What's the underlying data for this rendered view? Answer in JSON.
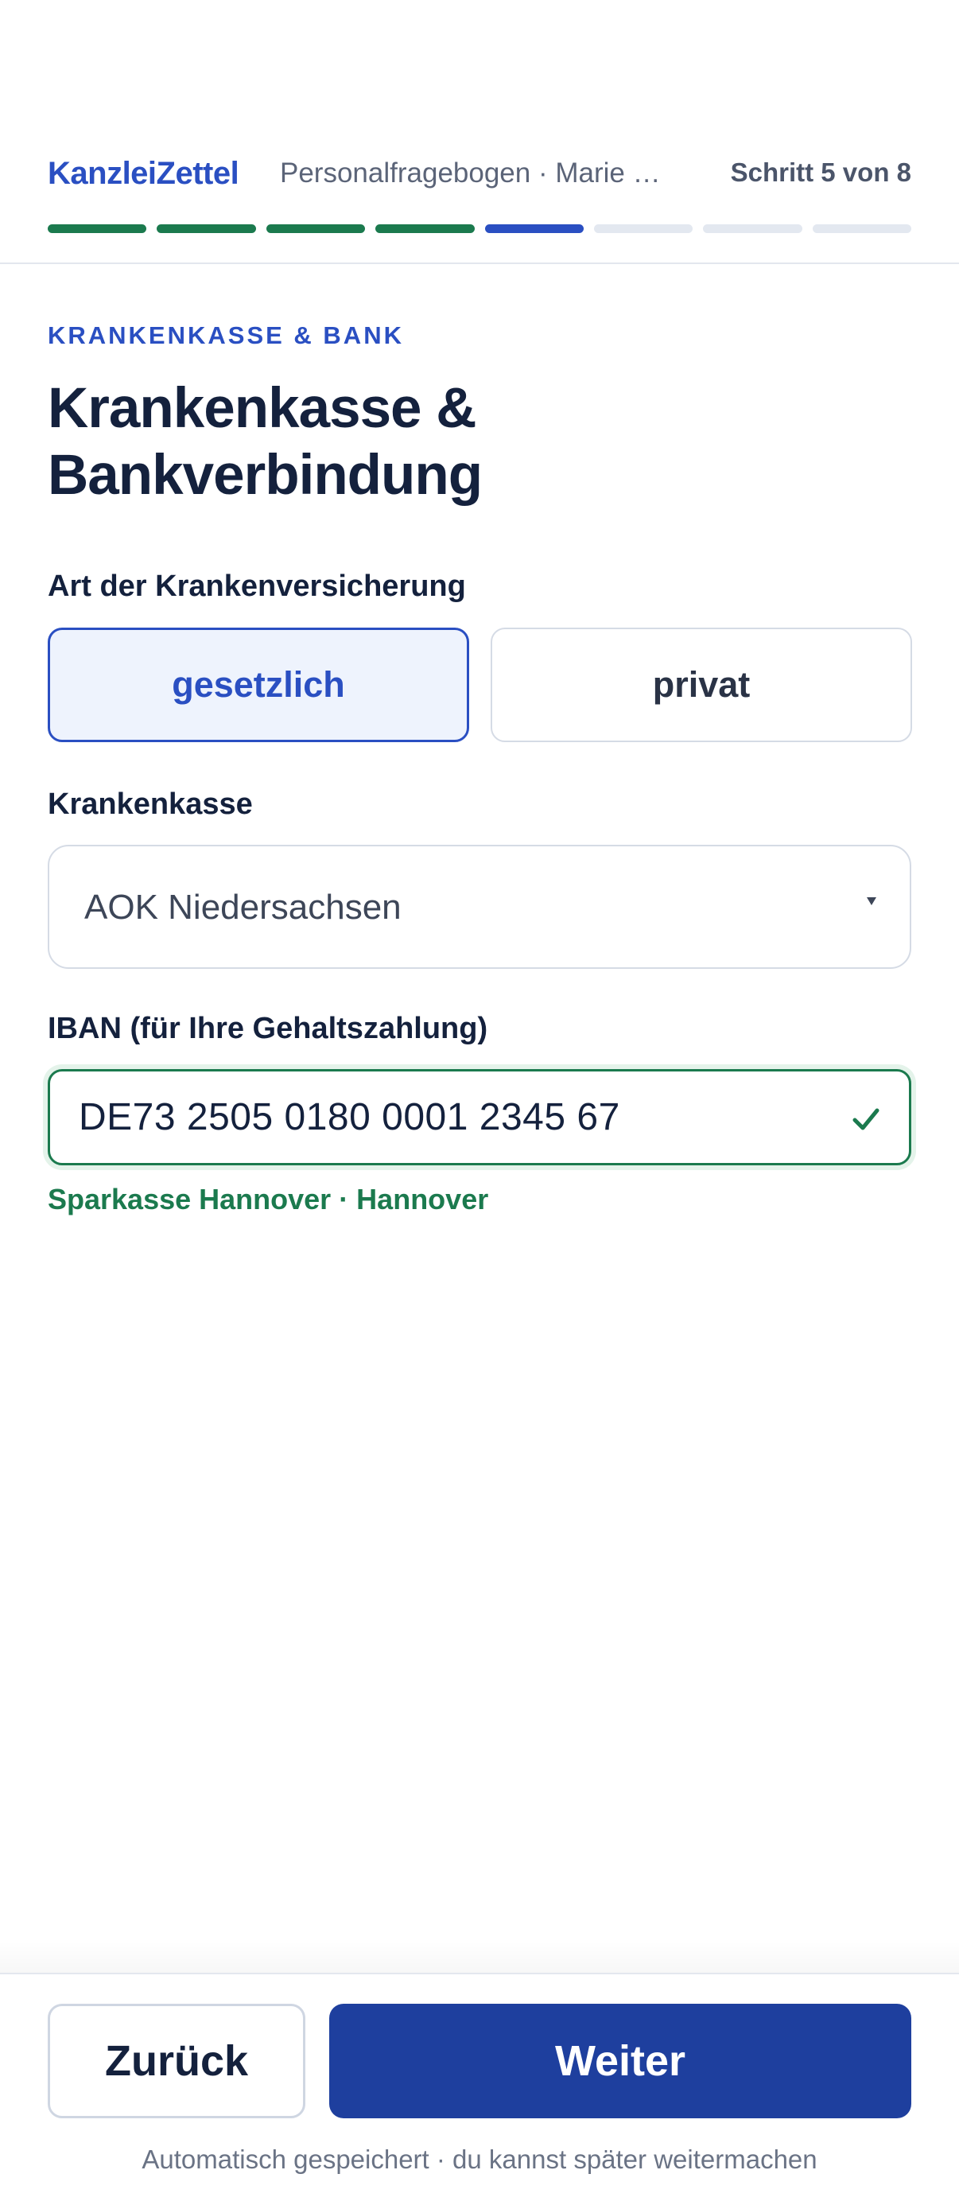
{
  "header": {
    "brand": "KanzleiZettel",
    "document_title": "Personalfragebogen · Marie …",
    "step_label": "Schritt 5 von 8",
    "progress": {
      "total_steps": 8,
      "completed_steps": 4,
      "current_step": 5
    }
  },
  "main": {
    "eyebrow": "KRANKENKASSE & BANK",
    "title": "Krankenkasse & Bankverbindung",
    "insurance_type": {
      "label": "Art der Krankenversicherung",
      "options": [
        "gesetzlich",
        "privat"
      ],
      "selected": "gesetzlich"
    },
    "health_insurer": {
      "label": "Krankenkasse",
      "value": "AOK Niedersachsen"
    },
    "iban": {
      "label": "IBAN (für Ihre Gehaltszahlung)",
      "value": "DE73 2505 0180 0001 2345 67",
      "bank_info": "Sparkasse Hannover · Hannover",
      "valid": true
    }
  },
  "footer": {
    "back_label": "Zurück",
    "next_label": "Weiter",
    "autosave_note": "Automatisch gespeichert · du kannst später weitermachen"
  },
  "colors": {
    "accent": "#2a4fc2",
    "primary_button": "#1e3f9e",
    "success": "#1b7a4e",
    "text": "#14213d"
  }
}
